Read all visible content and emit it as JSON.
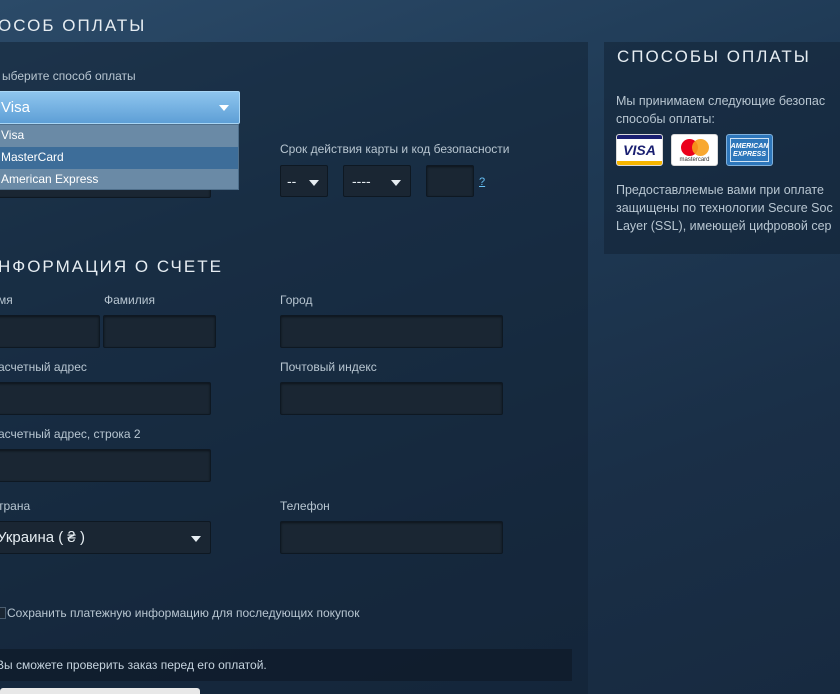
{
  "payment": {
    "title": "ОСОБ ОПЛАТЫ",
    "method_label": "ыберите способ оплаты",
    "selected_method": "Visa",
    "options": [
      "Visa",
      "MasterCard",
      "American Express"
    ],
    "expiry_label": "Срок действия карты и код безопасности",
    "month_value": "--",
    "year_value": "----",
    "cvv_help": "?"
  },
  "billing": {
    "title": "НФОРМАЦИЯ О СЧЕТЕ",
    "first_name_label": "мя",
    "last_name_label": "Фамилия",
    "city_label": "Город",
    "address_label": "асчетный адрес",
    "zip_label": "Почтовый индекс",
    "address2_label": "асчетный адрес, строка 2",
    "country_label": "трана",
    "country_value": "Украина ( ₴ )",
    "phone_label": "Телефон",
    "save_label": "Сохранить платежную информацию для последующих покупок",
    "notice": "Вы сможете проверить заказ перед его оплатой."
  },
  "sidebar": {
    "title": "СПОСОБЫ ОПЛАТЫ",
    "accept_line1": "Мы принимаем следующие безопас",
    "accept_line2": "способы оплаты:",
    "cards": {
      "visa": "VISA",
      "mastercard": "mastercard",
      "amex_line1": "AMERICAN",
      "amex_line2": "EXPRESS"
    },
    "secure_line1": "Предоставляемые вами при оплате",
    "secure_line2": "защищены по технологии Secure Soc",
    "secure_line3": "Layer (SSL), имеющей цифровой сер"
  },
  "colors": {
    "accent": "#67c1f5",
    "dropdown_highlight": "#3d6d99",
    "field_bg": "#1a2633"
  }
}
